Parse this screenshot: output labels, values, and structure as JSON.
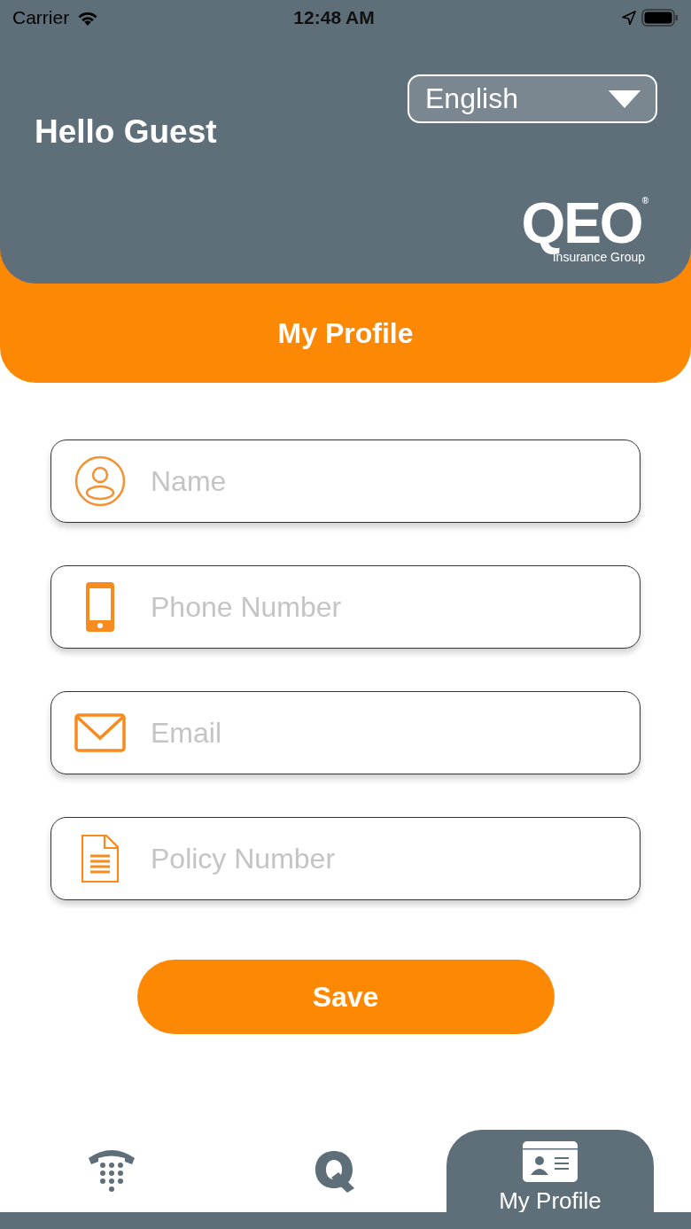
{
  "status_bar": {
    "carrier": "Carrier",
    "time": "12:48 AM"
  },
  "header": {
    "greeting": "Hello Guest",
    "language": "English",
    "logo": {
      "mark": "QEO",
      "registered": "®",
      "tagline": "Insurance Group"
    }
  },
  "title": "My Profile",
  "fields": [
    {
      "kind": "person",
      "placeholder": "Name"
    },
    {
      "kind": "phone",
      "placeholder": "Phone Number"
    },
    {
      "kind": "mail",
      "placeholder": "Email"
    },
    {
      "kind": "document",
      "placeholder": "Policy Number"
    }
  ],
  "save_button": "Save",
  "tab_bar": [
    {
      "kind": "dialpad",
      "selected": false
    },
    {
      "kind": "logo",
      "selected": false
    },
    {
      "kind": "profile",
      "label": "My Profile",
      "selected": true
    }
  ]
}
